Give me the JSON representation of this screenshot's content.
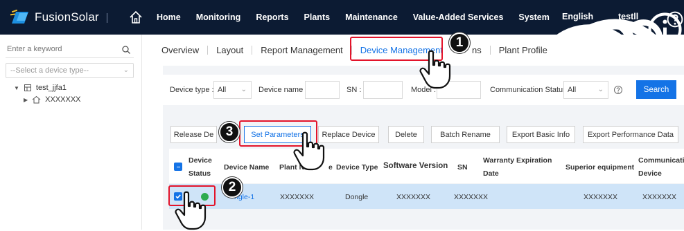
{
  "app": {
    "name": "FusionSolar"
  },
  "nav": [
    "Home",
    "Monitoring",
    "Reports",
    "Plants",
    "Maintenance",
    "Value-Added Services",
    "System"
  ],
  "header": {
    "language": "English",
    "user": "testll"
  },
  "sidebar": {
    "search_placeholder": "Enter a keyword",
    "type_placeholder": "--Select a device type--",
    "tree_root": "test_jjfa1",
    "tree_child": "XXXXXXX"
  },
  "tabs": [
    {
      "label": "Overview"
    },
    {
      "label": "Layout"
    },
    {
      "label": "Report Management"
    },
    {
      "label": "Device Management"
    },
    {
      "label": "ns"
    },
    {
      "label": "Plant Profile"
    }
  ],
  "filters": {
    "device_type_label": "Device type :",
    "device_type_value": "All",
    "device_name_label": "Device name :",
    "sn_label": "SN :",
    "model_label": "Model :",
    "comm_status_label": "Communication Status :",
    "comm_status_value": "All",
    "search_label": "Search"
  },
  "actions": [
    "Release De",
    "Set Parameters",
    "Replace Device",
    "Delete",
    "Batch Rename",
    "Export Basic Info",
    "Export Performance Data"
  ],
  "table": {
    "headers": {
      "device_status_1": "Device",
      "device_status_2": "Status",
      "device_name": "Device Name",
      "plant_name": "Plant N",
      "plant_name_tail": "e",
      "device_type": "Device Type",
      "software_version": "Software Version",
      "sn": "SN",
      "warranty_1": "Warranty Expiration",
      "warranty_2": "Date",
      "superior": "Superior equipment",
      "comm_device_1": "Communicatio",
      "comm_device_2": "Device"
    },
    "row": {
      "device_name": "ngle-1",
      "plant_name": "XXXXXXX",
      "device_type": "Dongle",
      "software_version": "XXXXXXX",
      "sn": "XXXXXXX",
      "superior": "XXXXXXX",
      "comm_device": "XXXXXXX",
      "status_color": "#2dab4f"
    }
  },
  "annotations": {
    "step1": "1",
    "step2": "2",
    "step3": "3"
  },
  "colors": {
    "accent": "#1473e6",
    "topbar": "#0c1b33",
    "highlight": "#e3132a",
    "row_selected": "#cfe4f8"
  }
}
